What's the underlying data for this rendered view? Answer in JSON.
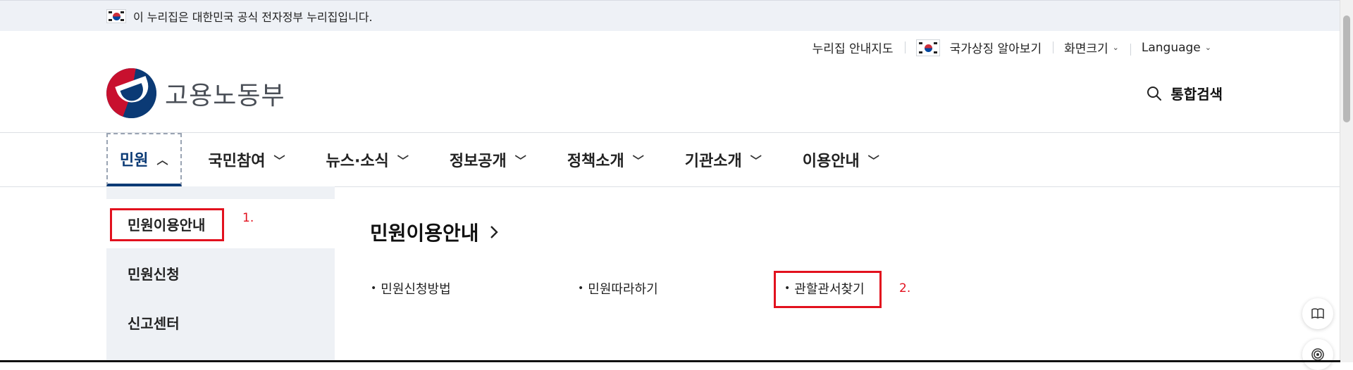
{
  "banner": {
    "text": "이 누리집은 대한민국 공식 전자정부 누리집입니다."
  },
  "util": {
    "sitemap": "누리집 안내지도",
    "symbols": "국가상징 알아보기",
    "zoom": "화면크기",
    "language": "Language"
  },
  "logo": {
    "text": "고용노동부"
  },
  "search": {
    "label": "통합검색"
  },
  "gnb": {
    "items": [
      {
        "label": "민원"
      },
      {
        "label": "국민참여"
      },
      {
        "label": "뉴스·소식"
      },
      {
        "label": "정보공개"
      },
      {
        "label": "정책소개"
      },
      {
        "label": "기관소개"
      },
      {
        "label": "이용안내"
      }
    ]
  },
  "lnb": {
    "items": [
      {
        "label": "민원이용안내"
      },
      {
        "label": "민원신청"
      },
      {
        "label": "신고센터"
      }
    ]
  },
  "content": {
    "title": "민원이용안내",
    "links": [
      {
        "label": "민원신청방법"
      },
      {
        "label": "민원따라하기"
      },
      {
        "label": "관할관서찾기"
      }
    ]
  },
  "annotations": {
    "one": "1.",
    "two": "2."
  },
  "colors": {
    "highlight": "#e2111e",
    "brand_navy": "#0b3a75",
    "banner_bg": "#eef1f6"
  }
}
